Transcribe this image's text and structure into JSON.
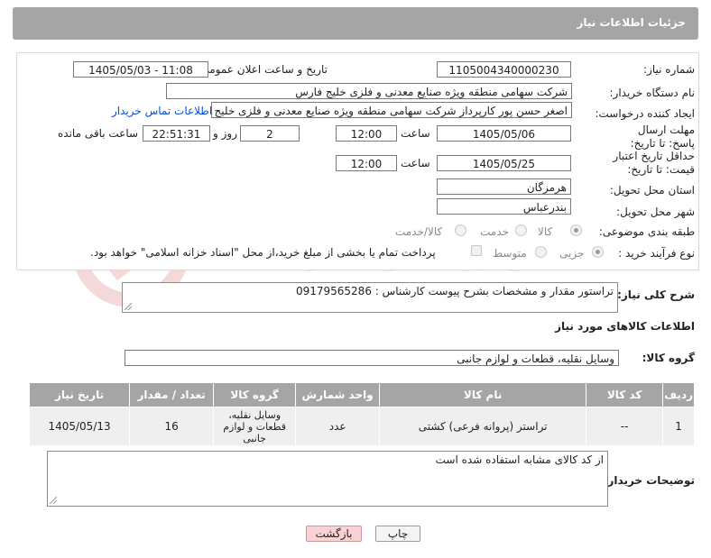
{
  "header": {
    "title": "جزئيات اطلاعات نياز"
  },
  "form": {
    "need_number_label": "شماره نياز:",
    "need_number": "1105004340000230",
    "announce_label": "تاريخ و ساعت اعلان عمومی:",
    "announce_value": "1405/05/03 - 11:08",
    "buyer_org_label": "نام دستگاه خريدار:",
    "buyer_org": "شرکت سهامی منطقه ويژه صنايع معدنی و فلزی خليج فارس",
    "requester_label": "ايجاد کننده درخواست:",
    "requester": "اصغر حسن پور کارپرداز شرکت سهامی منطقه ويژه صنايع معدنی و فلزی خليج ف",
    "contact_link": "اطلاعات تماس خريدار",
    "deadline_label": "مهلت ارسال پاسخ: تا تاريخ:",
    "deadline_date": "1405/05/06",
    "time_label": "ساعت",
    "deadline_time": "12:00",
    "days_value": "2",
    "days_label": "روز و",
    "remaining_time": "22:51:31",
    "remaining_label": "ساعت باقی مانده",
    "price_validity_label": "حداقل تاريخ اعتبار قيمت: تا تاريخ:",
    "price_validity_date": "1405/05/25",
    "price_validity_time": "12:00",
    "province_label": "استان محل تحويل:",
    "province": "هرمزگان",
    "city_label": "شهر محل تحويل:",
    "city": "بندرعباس",
    "category_label": "طبقه بندی موضوعی:",
    "category_options": [
      "کالا",
      "خدمت",
      "کالا/خدمت"
    ],
    "category_selected": "کالا",
    "process_label": "نوع فرآيند خريد :",
    "process_options": [
      "جزيی",
      "متوسط"
    ],
    "process_selected": "جزيی",
    "payment_note": "پرداخت تمام يا بخشی از مبلغ خريد،از محل \"اسناد خزانه اسلامی\" خواهد بود."
  },
  "description": {
    "label": "شرح کلی نياز:",
    "value": "تراستور مقدار و مشخصات بشرح پيوست کارشناس : 09179565286"
  },
  "goods_section": {
    "title": "اطلاعات کالاهای مورد نياز",
    "group_label": "گروه کالا:",
    "group_value": "وسايل نقليه، قطعات و لوازم جانبی"
  },
  "table": {
    "headers": [
      "رديف",
      "کد کالا",
      "نام کالا",
      "واحد شمارش",
      "گروه کالا",
      "تعداد / مقدار",
      "تاريخ نياز"
    ],
    "rows": [
      {
        "row": "1",
        "code": "--",
        "name": "تراستر (پروانه فرعی) کشتی",
        "unit": "عدد",
        "group": "وسايل نقليه، قطعات و لوازم جانبی",
        "qty": "16",
        "date": "1405/05/13"
      }
    ]
  },
  "buyer_notes": {
    "label": "توضيحات خريدار:",
    "value": "از کد کالای مشابه استفاده شده است"
  },
  "buttons": {
    "print": "چاپ",
    "back": "بازگشت"
  },
  "watermark": {
    "text": "AriaTender.net"
  },
  "colors": {
    "header_bg": "#a5a5a5",
    "link": "#0b4fd1",
    "back_button": "#f9d3d3"
  }
}
